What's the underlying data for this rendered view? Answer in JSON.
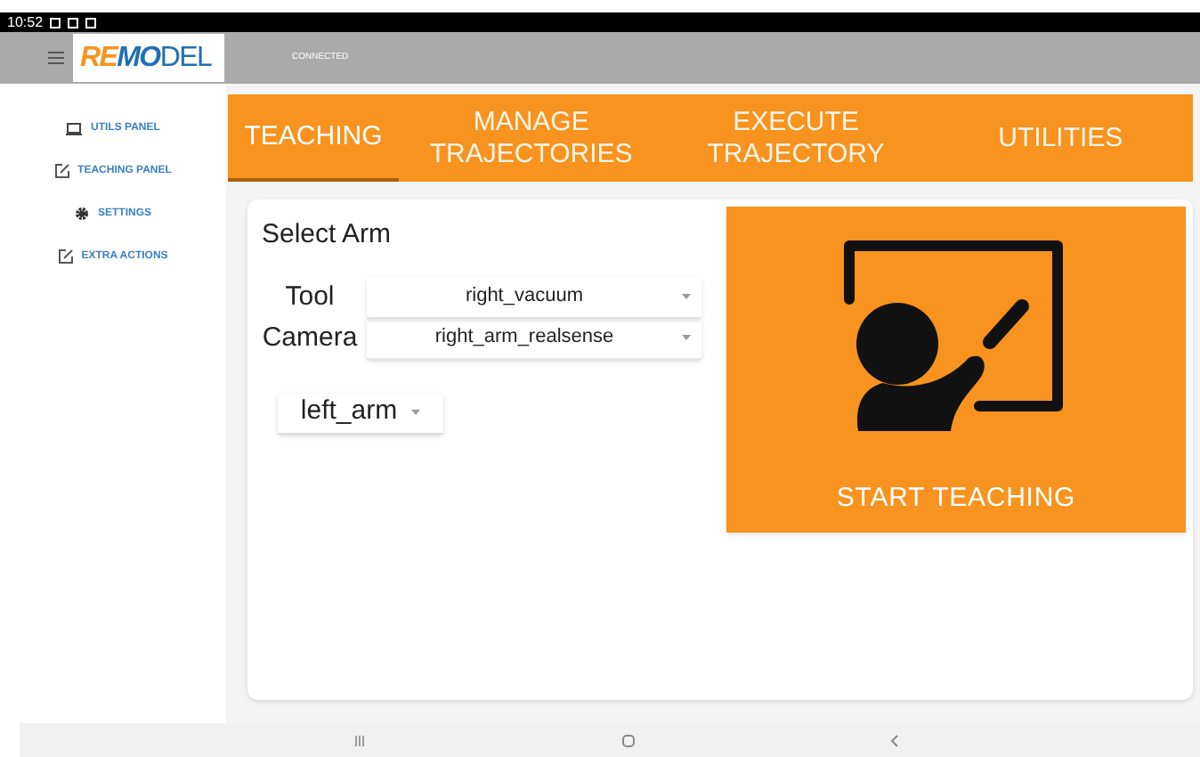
{
  "status_bar": {
    "time": "10:52"
  },
  "app_bar": {
    "logo": "REMODEL",
    "connection": "CONNECTED"
  },
  "sidebar": {
    "items": [
      {
        "label": "UTILS PANEL",
        "kind": "laptop"
      },
      {
        "label": "TEACHING PANEL",
        "kind": "edit"
      },
      {
        "label": "SETTINGS",
        "kind": "gear"
      },
      {
        "label": "EXTRA ACTIONS",
        "kind": "edit"
      }
    ]
  },
  "tabs": [
    {
      "label": "TEACHING",
      "selected": true
    },
    {
      "label": "MANAGE TRAJECTORIES",
      "selected": false
    },
    {
      "label": "EXECUTE TRAJECTORY",
      "selected": false
    },
    {
      "label": "UTILITIES",
      "selected": false
    }
  ],
  "teaching": {
    "title": "Select Arm",
    "fields": [
      {
        "label": "Tool",
        "value": "right_vacuum"
      },
      {
        "label": "Camera",
        "value": "right_arm_realsense"
      }
    ],
    "arm": {
      "value": "left_arm"
    },
    "start_button": "START TEACHING"
  }
}
